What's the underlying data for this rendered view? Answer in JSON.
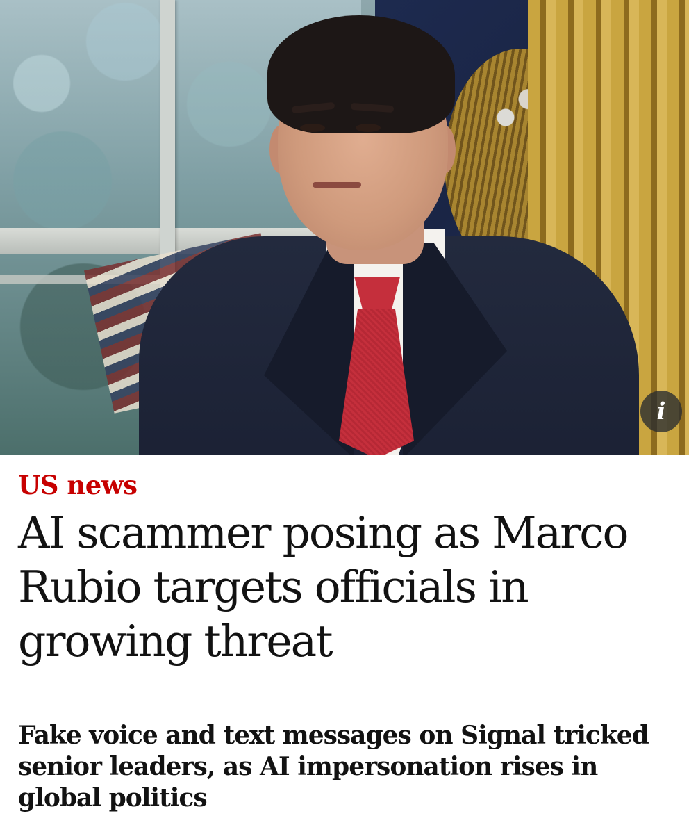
{
  "hero": {
    "alt": "Marco Rubio",
    "info_icon": "i"
  },
  "article": {
    "section": "US news",
    "headline": "AI scammer posing as Marco Rubio targets officials in growing threat",
    "standfirst": "Fake voice and text messages on Signal tricked senior leaders, as AI impersonation rises in global politics"
  },
  "colors": {
    "section_red": "#c70000",
    "text": "#121212",
    "background": "#ffffff"
  }
}
